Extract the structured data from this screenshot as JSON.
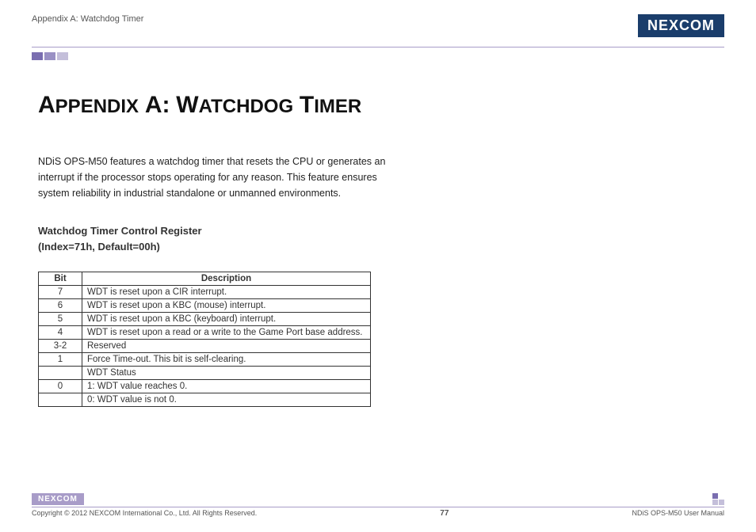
{
  "header": {
    "title": "Appendix A: Watchdog Timer",
    "logo": "NEXCOM"
  },
  "main": {
    "title": "Appendix A: Watchdog Timer",
    "intro": "NDiS OPS-M50 features a watchdog timer that resets the CPU or generates an interrupt if the processor stops operating for any reason. This feature ensures system reliability in industrial standalone or unmanned environments.",
    "registerTitleLine1": "Watchdog Timer Control Register",
    "registerTitleLine2": "(Index=71h, Default=00h)",
    "tableHeaders": {
      "bit": "Bit",
      "desc": "Description"
    },
    "rows": [
      {
        "bit": "7",
        "desc": "WDT is reset upon a CIR interrupt."
      },
      {
        "bit": "6",
        "desc": "WDT is reset upon a KBC (mouse) interrupt."
      },
      {
        "bit": "5",
        "desc": "WDT is reset upon a KBC (keyboard) interrupt."
      },
      {
        "bit": "4",
        "desc": "WDT is reset upon a read or a write to the Game Port base address."
      },
      {
        "bit": "3-2",
        "desc": "Reserved"
      },
      {
        "bit": "1",
        "desc": "Force Time-out. This bit is self-clearing."
      },
      {
        "bit": "",
        "desc": "WDT Status"
      },
      {
        "bit": "0",
        "desc": "1: WDT value reaches 0."
      },
      {
        "bit": "",
        "desc": "0: WDT value is not 0."
      }
    ]
  },
  "footer": {
    "logo": "NEXCOM",
    "copyright": "Copyright © 2012 NEXCOM International Co., Ltd. All Rights Reserved.",
    "page": "77",
    "docTitle": "NDiS OPS-M50 User Manual"
  }
}
